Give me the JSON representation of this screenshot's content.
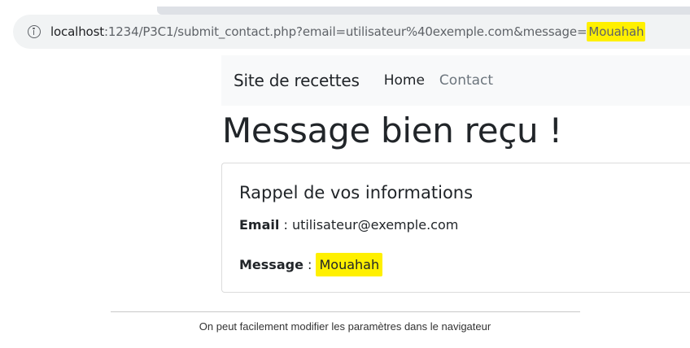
{
  "browser": {
    "url_host": "localhost",
    "url_rest": ":1234/P3C1/submit_contact.php?email=utilisateur%40exemple.com&message=",
    "url_highlighted": "Mouahah",
    "info_icon": "info-circle-icon",
    "highlight_color": "#fff000"
  },
  "navbar": {
    "brand": "Site de recettes",
    "links": [
      "Home",
      "Contact"
    ]
  },
  "page": {
    "title": "Message bien reçu !"
  },
  "card": {
    "title": "Rappel de vos informations",
    "email_label": "Email",
    "separator": " : ",
    "email_value": "utilisateur@exemple.com",
    "message_label": "Message",
    "message_value": "Mouahah"
  },
  "caption": "On peut facilement modifier les paramètres dans le navigateur"
}
